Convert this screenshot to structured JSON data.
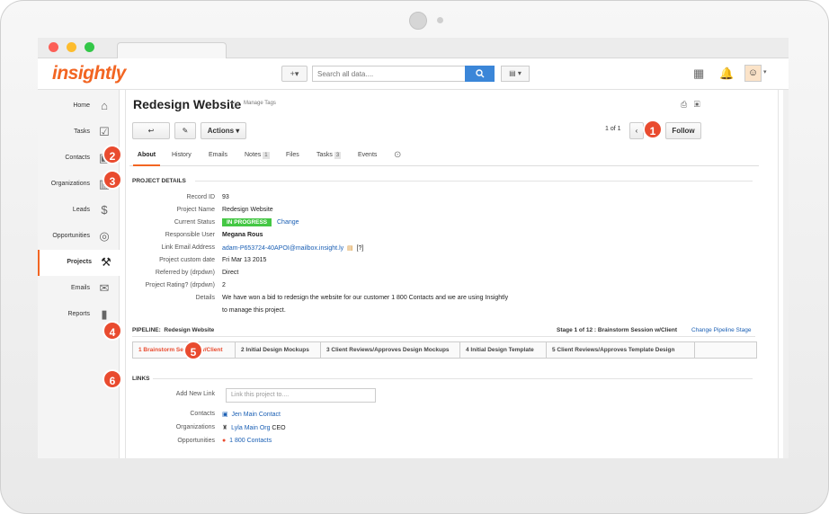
{
  "app": {
    "logo": "insightly"
  },
  "topbar": {
    "add_label": "+▾",
    "search_placeholder": "Search all data....",
    "view_label": "▤ ▾"
  },
  "sidebar": {
    "items": [
      {
        "label": "Home",
        "icon": "home-icon"
      },
      {
        "label": "Tasks",
        "icon": "tasks-icon"
      },
      {
        "label": "Contacts",
        "icon": "contacts-icon"
      },
      {
        "label": "Organizations",
        "icon": "organizations-icon"
      },
      {
        "label": "Leads",
        "icon": "leads-icon"
      },
      {
        "label": "Opportunities",
        "icon": "opportunities-icon"
      },
      {
        "label": "Projects",
        "icon": "projects-icon"
      },
      {
        "label": "Emails",
        "icon": "emails-icon"
      },
      {
        "label": "Reports",
        "icon": "reports-icon"
      }
    ]
  },
  "record": {
    "title": "Redesign Website",
    "manage_tags": "Manage Tags",
    "actions_label": "Actions ▾",
    "pager": "1 of 1",
    "follow_label": "Follow"
  },
  "tabs": [
    {
      "label": "About"
    },
    {
      "label": "History"
    },
    {
      "label": "Emails"
    },
    {
      "label": "Notes",
      "count": "1"
    },
    {
      "label": "Files"
    },
    {
      "label": "Tasks",
      "count": "3"
    },
    {
      "label": "Events"
    }
  ],
  "details": {
    "heading": "PROJECT DETAILS",
    "rows": [
      {
        "key": "Record ID",
        "value": "93"
      },
      {
        "key": "Project Name",
        "value": "Redesign Website"
      },
      {
        "key": "Current Status",
        "value": "IN PROGRESS",
        "extra": "Change"
      },
      {
        "key": "Responsible User",
        "value": "Megana Rous"
      },
      {
        "key": "Link Email Address",
        "value": "adam-P653724-40APOI@mailbox.insight.ly",
        "extra": "[?]"
      },
      {
        "key": "Project custom date",
        "value": "Fri Mar 13 2015"
      },
      {
        "key": "Referred by (drpdwn)",
        "value": "Direct"
      },
      {
        "key": "Project Rating? (drpdwn)",
        "value": "2"
      },
      {
        "key": "Details",
        "value": "We have won a bid to redesign the website for our customer 1 800 Contacts and we are using Insightly",
        "value2": "to manage this project."
      }
    ]
  },
  "pipeline": {
    "label": "PIPELINE:",
    "name": "Redesign Website",
    "stage_text": "Stage 1 of 12 : Brainstorm Session w/Client",
    "change_label": "Change Pipeline Stage",
    "stages": [
      "1 Brainstorm Session w/Client",
      "2 Initial Design Mockups",
      "3 Client Reviews/Approves Design Mockups",
      "4 Initial Design Template",
      "5 Client Reviews/Approves Template Design"
    ]
  },
  "links": {
    "heading": "LINKS",
    "add_label": "Add New Link",
    "add_placeholder": "Link this project to....",
    "rows": [
      {
        "key": "Contacts",
        "value": "Jen Main Contact",
        "suffix": ""
      },
      {
        "key": "Organizations",
        "value": "Lyla Main Org",
        "suffix": " CEO"
      },
      {
        "key": "Opportunities",
        "value": "1 800 Contacts",
        "suffix": ""
      }
    ]
  },
  "markers": [
    "1",
    "2",
    "3",
    "4",
    "5",
    "6"
  ],
  "colors": {
    "accent": "#f26522",
    "status_green": "#44c744",
    "link": "#1a5fb4",
    "marker": "#e94b2f"
  }
}
